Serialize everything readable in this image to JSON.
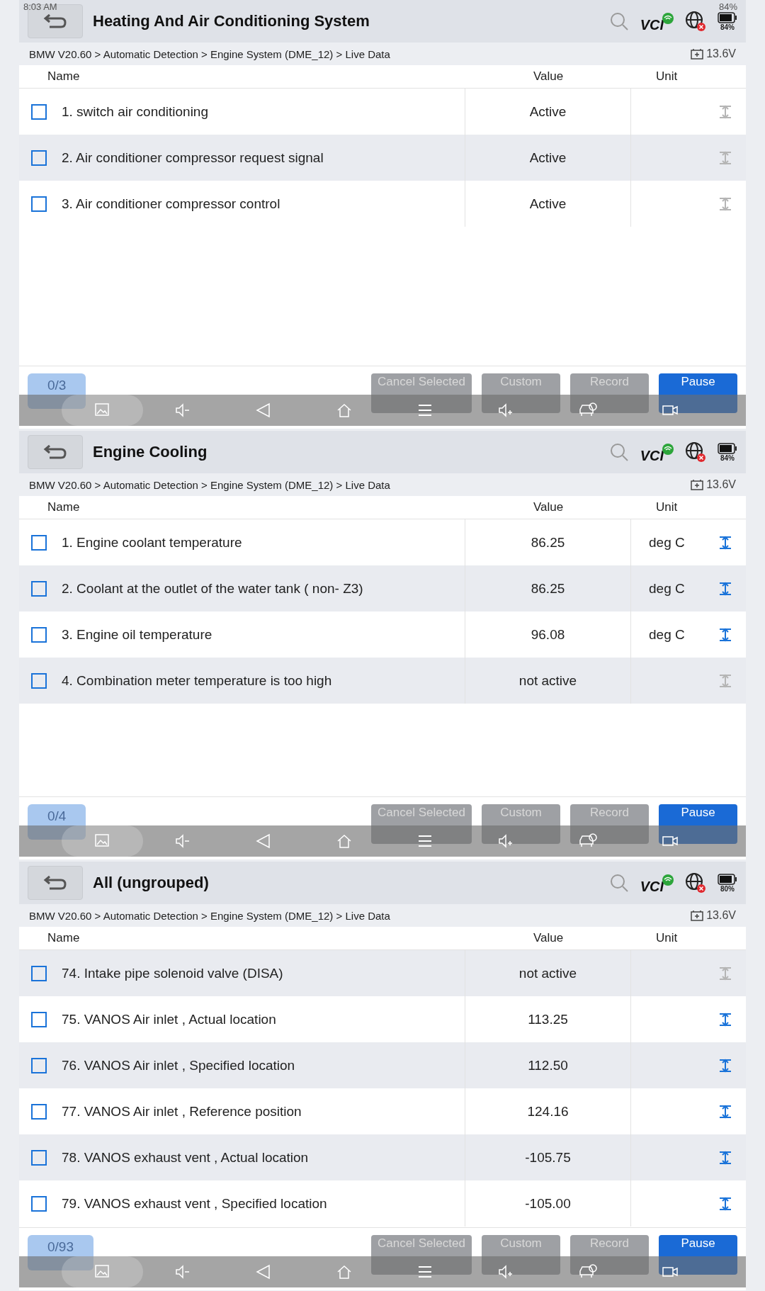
{
  "panels": [
    {
      "status_bar": {
        "time": "8:03 AM",
        "battery": "84%"
      },
      "title": "Heating And Air Conditioning System",
      "vci_label": "VCI",
      "battery_label": "84%",
      "breadcrumb": "BMW V20.60 > Automatic Detection  > Engine System (DME_12) > Live Data",
      "voltage": "13.6V",
      "columns": [
        "Name",
        "Value",
        "Unit"
      ],
      "rows": [
        {
          "name": "1. switch air conditioning",
          "value": "Active",
          "unit": "",
          "checked": false,
          "shaded": false,
          "graphable": false
        },
        {
          "name": "2. Air conditioner compressor request signal",
          "value": "Active",
          "unit": "",
          "checked": false,
          "shaded": true,
          "graphable": false
        },
        {
          "name": "3. Air conditioner compressor control",
          "value": "Active",
          "unit": "",
          "checked": false,
          "shaded": false,
          "graphable": false
        }
      ],
      "count": "0/3",
      "buttons": [
        {
          "label": "Cancel Selected",
          "disabled": true
        },
        {
          "label": "Custom",
          "disabled": true
        },
        {
          "label": "Record",
          "disabled": true
        },
        {
          "label": "Pause",
          "disabled": false
        }
      ]
    },
    {
      "title": "Engine Cooling",
      "vci_label": "VCI",
      "battery_label": "84%",
      "breadcrumb": "BMW V20.60 > Automatic Detection  > Engine System (DME_12) > Live Data",
      "voltage": "13.6V",
      "columns": [
        "Name",
        "Value",
        "Unit"
      ],
      "rows": [
        {
          "name": "1. Engine coolant temperature",
          "value": "86.25",
          "unit": "deg C",
          "checked": false,
          "shaded": false,
          "graphable": true
        },
        {
          "name": "2. Coolant at the outlet of the water tank ( non- Z3)",
          "value": "86.25",
          "unit": "deg C",
          "checked": false,
          "shaded": true,
          "graphable": true
        },
        {
          "name": "3. Engine oil temperature",
          "value": "96.08",
          "unit": "deg C",
          "checked": false,
          "shaded": false,
          "graphable": true
        },
        {
          "name": "4. Combination meter temperature is too high",
          "value": "not active",
          "unit": "",
          "checked": false,
          "shaded": true,
          "graphable": false
        }
      ],
      "count": "0/4",
      "buttons": [
        {
          "label": "Cancel Selected",
          "disabled": true
        },
        {
          "label": "Custom",
          "disabled": true
        },
        {
          "label": "Record",
          "disabled": true
        },
        {
          "label": "Pause",
          "disabled": false
        }
      ]
    },
    {
      "title": "All (ungrouped)",
      "vci_label": "VCI",
      "battery_label": "80%",
      "breadcrumb": "BMW V20.60 > Automatic Detection  > Engine System (DME_12) > Live Data",
      "voltage": "13.6V",
      "columns": [
        "Name",
        "Value",
        "Unit"
      ],
      "rows": [
        {
          "name": "74. Intake pipe solenoid valve (DISA)",
          "value": "not active",
          "unit": "",
          "checked": false,
          "shaded": true,
          "graphable": false
        },
        {
          "name": "75. VANOS Air inlet , Actual location",
          "value": "113.25",
          "unit": "",
          "checked": false,
          "shaded": false,
          "graphable": true
        },
        {
          "name": "76. VANOS Air inlet , Specified location",
          "value": "112.50",
          "unit": "",
          "checked": false,
          "shaded": true,
          "graphable": true
        },
        {
          "name": "77. VANOS Air inlet , Reference position",
          "value": "124.16",
          "unit": "",
          "checked": false,
          "shaded": false,
          "graphable": true
        },
        {
          "name": "78. VANOS exhaust vent , Actual location",
          "value": "-105.75",
          "unit": "",
          "checked": false,
          "shaded": true,
          "graphable": true
        },
        {
          "name": "79. VANOS exhaust vent , Specified location",
          "value": "-105.00",
          "unit": "",
          "checked": false,
          "shaded": false,
          "graphable": true
        }
      ],
      "count": "0/93",
      "buttons": [
        {
          "label": "Cancel Selected",
          "disabled": true
        },
        {
          "label": "Custom",
          "disabled": true
        },
        {
          "label": "Record",
          "disabled": true
        },
        {
          "label": "Pause",
          "disabled": false
        }
      ]
    }
  ]
}
